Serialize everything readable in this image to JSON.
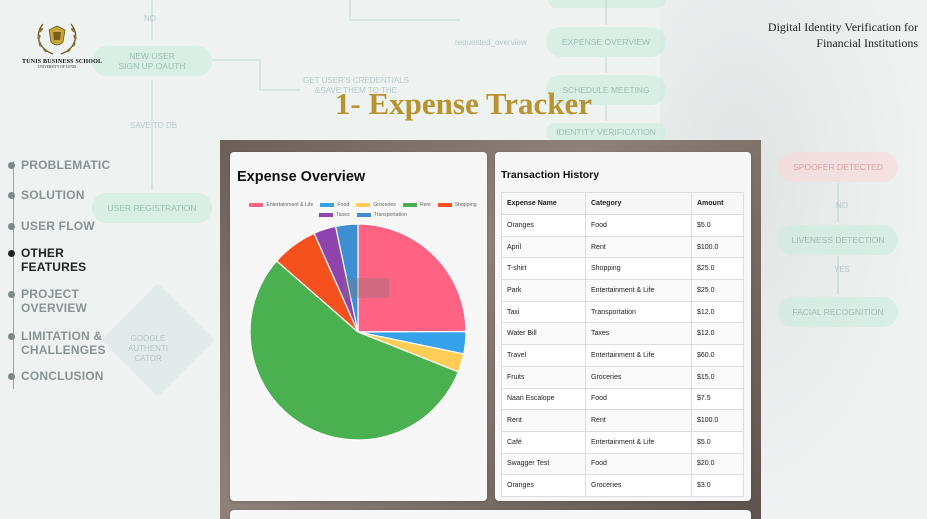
{
  "logo": {
    "line1": "TUNIS BUSINESS SCHOOL",
    "line2": "UNIVERSITY OF TUNIS"
  },
  "header": {
    "project_line1": "Digital Identity Verification for",
    "project_line2": "Financial Institutions"
  },
  "slide_title": "1- Expense Tracker",
  "nav": [
    {
      "label": "PROBLEMATIC",
      "active": false
    },
    {
      "label": "SOLUTION",
      "active": false
    },
    {
      "label": "USER FLOW",
      "active": false
    },
    {
      "label": "OTHER\nFEATURES",
      "active": true
    },
    {
      "label": "PROJECT\nOVERVIEW",
      "active": false
    },
    {
      "label": "LIMITATION &\nCHALLENGES",
      "active": false
    },
    {
      "label": "CONCLUSION",
      "active": false
    }
  ],
  "background_flow": {
    "no_1": "NO",
    "new_user": "NEW USER\nSIGN UP OAUTH",
    "credentials": "GET USER'S CREDENTIALS\n&SAVE THEM TO THE",
    "save_db": "SAVE TO DB",
    "user_registration": "USER REGISTRATION",
    "google_auth": "GOOGLE\nAUTHENTI\nCATOR",
    "expense_overview": "EXPENSE OVERVIEW",
    "schedule_meeting": "SCHEDULE MEETING",
    "identity_verification": "IDENTITY VERIFICATION",
    "spoofer_detected": "SPOOFER DETECTED",
    "no_2": "NO",
    "liveness_detection": "LIVENESS DETECTION",
    "yes": "YES",
    "facial_recognition": "FACIAL RECOGNITION",
    "requested_overview": "requested_overview"
  },
  "expense_card": {
    "title": "Expense Overview"
  },
  "transactions": {
    "title": "Transaction History",
    "columns": [
      "Expense Name",
      "Category",
      "Amount"
    ],
    "rows": [
      [
        "Oranges",
        "Food",
        "$5.0"
      ],
      [
        "April",
        "Rent",
        "$100.0"
      ],
      [
        "T-shirt",
        "Shopping",
        "$25.0"
      ],
      [
        "Park",
        "Entertainment & Life",
        "$25.0"
      ],
      [
        "Taxi",
        "Transportation",
        "$12.0"
      ],
      [
        "Water Bill",
        "Taxes",
        "$12.0"
      ],
      [
        "Travel",
        "Entertainment & Life",
        "$60.0"
      ],
      [
        "Fruits",
        "Groceries",
        "$15.0"
      ],
      [
        "Naan Escalope",
        "Food",
        "$7.5"
      ],
      [
        "Rent",
        "Rent",
        "$100.0"
      ],
      [
        "Café",
        "Entertainment & Life",
        "$5.0"
      ],
      [
        "Swagger Test",
        "Food",
        "$20.0"
      ],
      [
        "Oranges",
        "Groceries",
        "$3.0"
      ]
    ]
  },
  "chart_data": {
    "type": "pie",
    "title": "Expense Overview",
    "legend_position": "top",
    "series": [
      {
        "name": "Entertainment & Life",
        "value": 90,
        "color": "#ff6384"
      },
      {
        "name": "Food",
        "value": 12,
        "color": "#36a2eb"
      },
      {
        "name": "Groceries",
        "value": 10,
        "color": "#ffcd56"
      },
      {
        "name": "Rent",
        "value": 200,
        "color": "#4bb04f"
      },
      {
        "name": "Shopping",
        "value": 25,
        "color": "#f4511e"
      },
      {
        "name": "Taxes",
        "value": 12,
        "color": "#8e44ad"
      },
      {
        "name": "Transportation",
        "value": 12,
        "color": "#3d8fd1"
      }
    ]
  }
}
